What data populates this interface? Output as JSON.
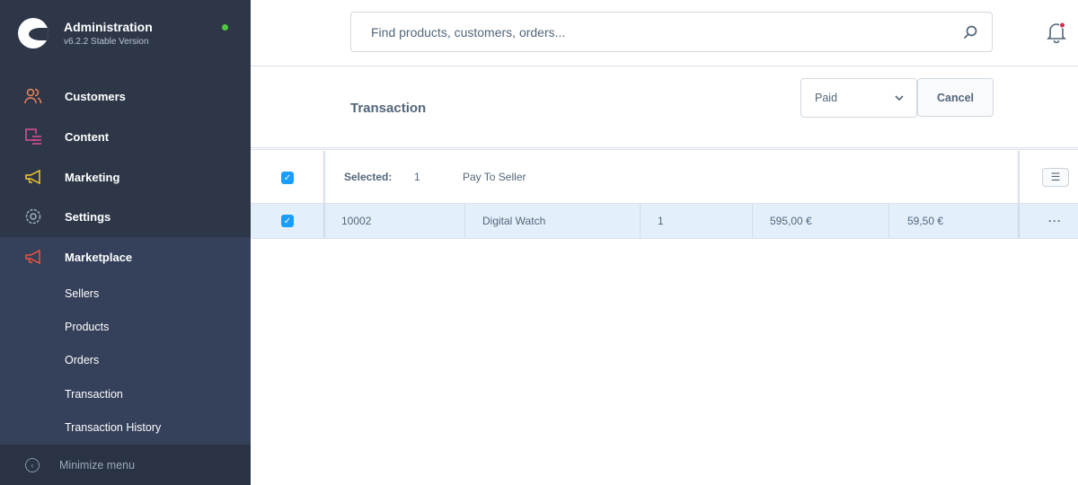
{
  "sidebar": {
    "title": "Administration",
    "version": "v6.2.2 Stable Version",
    "items": [
      {
        "label": "Customers",
        "icon": "users-icon",
        "color": "#f0855c"
      },
      {
        "label": "Content",
        "icon": "content-icon",
        "color": "#e14e9a"
      },
      {
        "label": "Marketing",
        "icon": "megaphone-icon",
        "color": "#f7c92b"
      },
      {
        "label": "Settings",
        "icon": "gear-icon",
        "color": "#a2afbe"
      },
      {
        "label": "Marketplace",
        "icon": "megaphone-icon",
        "color": "#f0533c"
      }
    ],
    "sub_items": [
      "Sellers",
      "Products",
      "Orders",
      "Transaction",
      "Transaction History"
    ],
    "minimize": "Minimize menu"
  },
  "search": {
    "placeholder": "Find products, customers, orders..."
  },
  "header": {
    "title": "Transaction",
    "status_select": "Paid",
    "cancel": "Cancel"
  },
  "bulk": {
    "selected_label": "Selected:",
    "selected_count": "1",
    "action": "Pay To Seller"
  },
  "rows": [
    {
      "id": "10002",
      "product": "Digital Watch",
      "qty": "1",
      "amount": "595,00 €",
      "commission": "59,50 €"
    }
  ]
}
